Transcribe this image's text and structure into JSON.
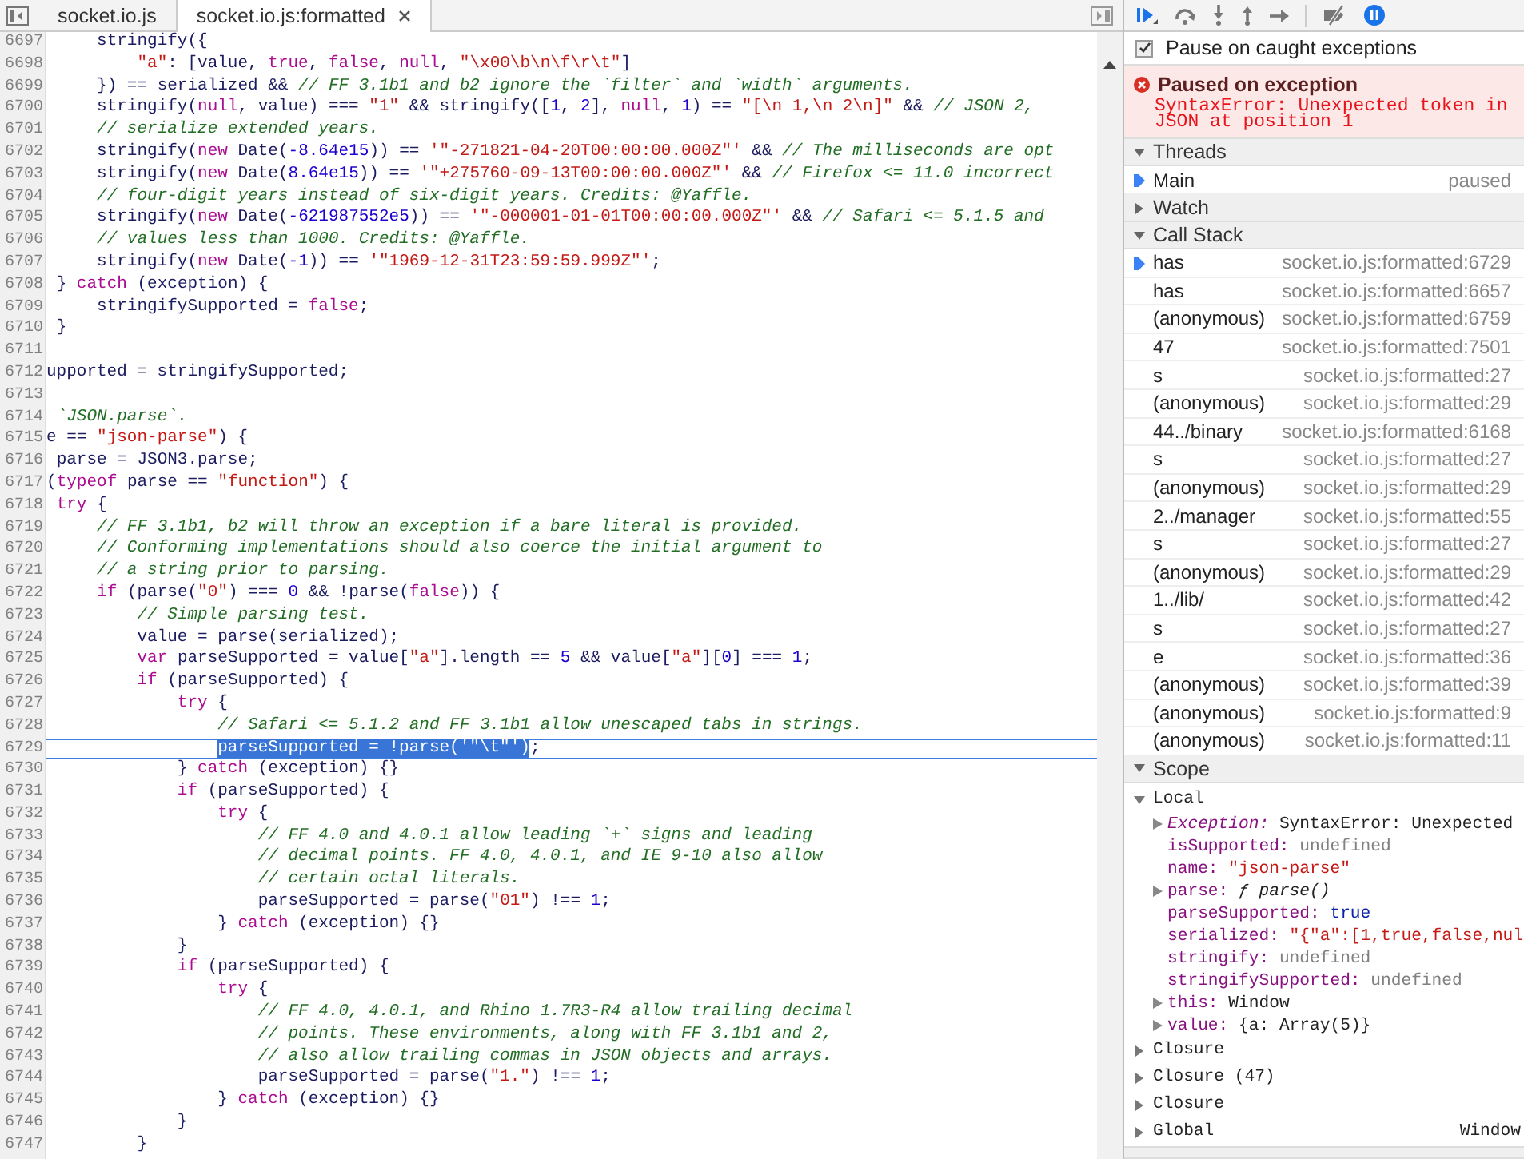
{
  "editor": {
    "tabs": [
      {
        "label": "socket.io.js",
        "selected": false,
        "closable": false
      },
      {
        "label": "socket.io.js:formatted",
        "selected": true,
        "closable": true
      }
    ],
    "lines": [
      {
        "number": "6697",
        "current": false,
        "tokens": [
          {
            "kind": "p",
            "text": "     stringify({"
          }
        ]
      },
      {
        "number": "6698",
        "current": false,
        "tokens": [
          {
            "kind": "str",
            "text": "         \"a\""
          },
          {
            "kind": "p",
            "text": ": [value, "
          },
          {
            "kind": "kw",
            "text": "true"
          },
          {
            "kind": "p",
            "text": ", "
          },
          {
            "kind": "kw",
            "text": "false"
          },
          {
            "kind": "p",
            "text": ", "
          },
          {
            "kind": "kw",
            "text": "null"
          },
          {
            "kind": "p",
            "text": ", "
          },
          {
            "kind": "str",
            "text": "\"\\x00\\b\\n\\f\\r\\t\""
          },
          {
            "kind": "p",
            "text": "]"
          }
        ]
      },
      {
        "number": "6699",
        "current": false,
        "tokens": [
          {
            "kind": "p",
            "text": "     }) == serialized && "
          },
          {
            "kind": "cm",
            "text": "// FF 3.1b1 and b2 ignore the `filter` and `width` arguments."
          }
        ]
      },
      {
        "number": "6700",
        "current": false,
        "tokens": [
          {
            "kind": "p",
            "text": "     stringify("
          },
          {
            "kind": "kw",
            "text": "null"
          },
          {
            "kind": "p",
            "text": ", value) === "
          },
          {
            "kind": "str",
            "text": "\"1\""
          },
          {
            "kind": "p",
            "text": " && stringify(["
          },
          {
            "kind": "num",
            "text": "1"
          },
          {
            "kind": "p",
            "text": ", "
          },
          {
            "kind": "num",
            "text": "2"
          },
          {
            "kind": "p",
            "text": "], "
          },
          {
            "kind": "kw",
            "text": "null"
          },
          {
            "kind": "p",
            "text": ", "
          },
          {
            "kind": "num",
            "text": "1"
          },
          {
            "kind": "p",
            "text": ") == "
          },
          {
            "kind": "str",
            "text": "\"[\\n 1,\\n 2\\n]\""
          },
          {
            "kind": "p",
            "text": " && "
          },
          {
            "kind": "cm",
            "text": "// JSON 2,"
          }
        ]
      },
      {
        "number": "6701",
        "current": false,
        "tokens": [
          {
            "kind": "cm",
            "text": "     // serialize extended years."
          }
        ]
      },
      {
        "number": "6702",
        "current": false,
        "tokens": [
          {
            "kind": "p",
            "text": "     stringify("
          },
          {
            "kind": "kw",
            "text": "new"
          },
          {
            "kind": "p",
            "text": " Date("
          },
          {
            "kind": "num",
            "text": "-8.64e15"
          },
          {
            "kind": "p",
            "text": ")) == "
          },
          {
            "kind": "str",
            "text": "'\"-271821-04-20T00:00:00.000Z\"'"
          },
          {
            "kind": "p",
            "text": " && "
          },
          {
            "kind": "cm",
            "text": "// The milliseconds are opt"
          }
        ]
      },
      {
        "number": "6703",
        "current": false,
        "tokens": [
          {
            "kind": "p",
            "text": "     stringify("
          },
          {
            "kind": "kw",
            "text": "new"
          },
          {
            "kind": "p",
            "text": " Date("
          },
          {
            "kind": "num",
            "text": "8.64e15"
          },
          {
            "kind": "p",
            "text": ")) == "
          },
          {
            "kind": "str",
            "text": "'\"+275760-09-13T00:00:00.000Z\"'"
          },
          {
            "kind": "p",
            "text": " && "
          },
          {
            "kind": "cm",
            "text": "// Firefox <= 11.0 incorrect"
          }
        ]
      },
      {
        "number": "6704",
        "current": false,
        "tokens": [
          {
            "kind": "cm",
            "text": "     // four-digit years instead of six-digit years. Credits: @Yaffle."
          }
        ]
      },
      {
        "number": "6705",
        "current": false,
        "tokens": [
          {
            "kind": "p",
            "text": "     stringify("
          },
          {
            "kind": "kw",
            "text": "new"
          },
          {
            "kind": "p",
            "text": " Date("
          },
          {
            "kind": "num",
            "text": "-621987552e5"
          },
          {
            "kind": "p",
            "text": ")) == "
          },
          {
            "kind": "str",
            "text": "'\"-000001-01-01T00:00:00.000Z\"'"
          },
          {
            "kind": "p",
            "text": " && "
          },
          {
            "kind": "cm",
            "text": "// Safari <= 5.1.5 and"
          }
        ]
      },
      {
        "number": "6706",
        "current": false,
        "tokens": [
          {
            "kind": "cm",
            "text": "     // values less than 1000. Credits: @Yaffle."
          }
        ]
      },
      {
        "number": "6707",
        "current": false,
        "tokens": [
          {
            "kind": "p",
            "text": "     stringify("
          },
          {
            "kind": "kw",
            "text": "new"
          },
          {
            "kind": "p",
            "text": " Date("
          },
          {
            "kind": "num",
            "text": "-1"
          },
          {
            "kind": "p",
            "text": ")) == "
          },
          {
            "kind": "str",
            "text": "'\"1969-12-31T23:59:59.999Z\"'"
          },
          {
            "kind": "p",
            "text": ";"
          }
        ]
      },
      {
        "number": "6708",
        "current": false,
        "tokens": [
          {
            "kind": "p",
            "text": " } "
          },
          {
            "kind": "kw",
            "text": "catch"
          },
          {
            "kind": "p",
            "text": " (exception) {"
          }
        ]
      },
      {
        "number": "6709",
        "current": false,
        "tokens": [
          {
            "kind": "p",
            "text": "     stringifySupported = "
          },
          {
            "kind": "kw",
            "text": "false"
          },
          {
            "kind": "p",
            "text": ";"
          }
        ]
      },
      {
        "number": "6710",
        "current": false,
        "tokens": [
          {
            "kind": "p",
            "text": " }"
          }
        ]
      },
      {
        "number": "6711",
        "current": false
      },
      {
        "number": "6712",
        "current": false,
        "tokens": [
          {
            "kind": "p",
            "text": "upported = stringifySupported;"
          }
        ]
      },
      {
        "number": "6713",
        "current": false
      },
      {
        "number": "6714",
        "current": false,
        "tokens": [
          {
            "kind": "cm",
            "text": " `JSON.parse`."
          }
        ]
      },
      {
        "number": "6715",
        "current": false,
        "tokens": [
          {
            "kind": "p",
            "text": "e == "
          },
          {
            "kind": "str",
            "text": "\"json-parse\""
          },
          {
            "kind": "p",
            "text": ") {"
          }
        ]
      },
      {
        "number": "6716",
        "current": false,
        "tokens": [
          {
            "kind": "p",
            "text": " parse = JSON3.parse;"
          }
        ]
      },
      {
        "number": "6717",
        "current": false,
        "tokens": [
          {
            "kind": "p",
            "text": "("
          },
          {
            "kind": "kw",
            "text": "typeof"
          },
          {
            "kind": "p",
            "text": " parse == "
          },
          {
            "kind": "str",
            "text": "\"function\""
          },
          {
            "kind": "p",
            "text": ") {"
          }
        ]
      },
      {
        "number": "6718",
        "current": false,
        "tokens": [
          {
            "kind": "kw",
            "text": " try"
          },
          {
            "kind": "p",
            "text": " {"
          }
        ]
      },
      {
        "number": "6719",
        "current": false,
        "tokens": [
          {
            "kind": "cm",
            "text": "     // FF 3.1b1, b2 will throw an exception if a bare literal is provided."
          }
        ]
      },
      {
        "number": "6720",
        "current": false,
        "tokens": [
          {
            "kind": "cm",
            "text": "     // Conforming implementations should also coerce the initial argument to"
          }
        ]
      },
      {
        "number": "6721",
        "current": false,
        "tokens": [
          {
            "kind": "cm",
            "text": "     // a string prior to parsing."
          }
        ]
      },
      {
        "number": "6722",
        "current": false,
        "tokens": [
          {
            "kind": "kw",
            "text": "     if"
          },
          {
            "kind": "p",
            "text": " (parse("
          },
          {
            "kind": "str",
            "text": "\"0\""
          },
          {
            "kind": "p",
            "text": ") === "
          },
          {
            "kind": "num",
            "text": "0"
          },
          {
            "kind": "p",
            "text": " && !parse("
          },
          {
            "kind": "kw",
            "text": "false"
          },
          {
            "kind": "p",
            "text": ")) {"
          }
        ]
      },
      {
        "number": "6723",
        "current": false,
        "tokens": [
          {
            "kind": "cm",
            "text": "         // Simple parsing test."
          }
        ]
      },
      {
        "number": "6724",
        "current": false,
        "tokens": [
          {
            "kind": "p",
            "text": "         value = parse(serialized);"
          }
        ]
      },
      {
        "number": "6725",
        "current": false,
        "tokens": [
          {
            "kind": "kw",
            "text": "         var"
          },
          {
            "kind": "p",
            "text": " parseSupported = value["
          },
          {
            "kind": "str",
            "text": "\"a\""
          },
          {
            "kind": "p",
            "text": "].length == "
          },
          {
            "kind": "num",
            "text": "5"
          },
          {
            "kind": "p",
            "text": " && value["
          },
          {
            "kind": "str",
            "text": "\"a\""
          },
          {
            "kind": "p",
            "text": "]["
          },
          {
            "kind": "num",
            "text": "0"
          },
          {
            "kind": "p",
            "text": "] === "
          },
          {
            "kind": "num",
            "text": "1"
          },
          {
            "kind": "p",
            "text": ";"
          }
        ]
      },
      {
        "number": "6726",
        "current": false,
        "tokens": [
          {
            "kind": "kw",
            "text": "         if"
          },
          {
            "kind": "p",
            "text": " (parseSupported) {"
          }
        ]
      },
      {
        "number": "6727",
        "current": false,
        "tokens": [
          {
            "kind": "kw",
            "text": "             try"
          },
          {
            "kind": "p",
            "text": " {"
          }
        ]
      },
      {
        "number": "6728",
        "current": false,
        "tokens": [
          {
            "kind": "cm",
            "text": "                 // Safari <= 5.1.2 and FF 3.1b1 allow unescaped tabs in strings."
          }
        ]
      },
      {
        "number": "6729",
        "current": true,
        "tokens": [
          {
            "kind": "sel",
            "text": "                 parseSupported = !parse('\"\\t\"')"
          },
          {
            "kind": "p",
            "text": ";"
          }
        ]
      },
      {
        "number": "6730",
        "current": false,
        "tokens": [
          {
            "kind": "p",
            "text": "             } "
          },
          {
            "kind": "kw",
            "text": "catch"
          },
          {
            "kind": "p",
            "text": " (exception) {}"
          }
        ]
      },
      {
        "number": "6731",
        "current": false,
        "tokens": [
          {
            "kind": "kw",
            "text": "             if"
          },
          {
            "kind": "p",
            "text": " (parseSupported) {"
          }
        ]
      },
      {
        "number": "6732",
        "current": false,
        "tokens": [
          {
            "kind": "kw",
            "text": "                 try"
          },
          {
            "kind": "p",
            "text": " {"
          }
        ]
      },
      {
        "number": "6733",
        "current": false,
        "tokens": [
          {
            "kind": "cm",
            "text": "                     // FF 4.0 and 4.0.1 allow leading `+` signs and leading"
          }
        ]
      },
      {
        "number": "6734",
        "current": false,
        "tokens": [
          {
            "kind": "cm",
            "text": "                     // decimal points. FF 4.0, 4.0.1, and IE 9-10 also allow"
          }
        ]
      },
      {
        "number": "6735",
        "current": false,
        "tokens": [
          {
            "kind": "cm",
            "text": "                     // certain octal literals."
          }
        ]
      },
      {
        "number": "6736",
        "current": false,
        "tokens": [
          {
            "kind": "p",
            "text": "                     parseSupported = parse("
          },
          {
            "kind": "str",
            "text": "\"01\""
          },
          {
            "kind": "p",
            "text": ") !== "
          },
          {
            "kind": "num",
            "text": "1"
          },
          {
            "kind": "p",
            "text": ";"
          }
        ]
      },
      {
        "number": "6737",
        "current": false,
        "tokens": [
          {
            "kind": "p",
            "text": "                 } "
          },
          {
            "kind": "kw",
            "text": "catch"
          },
          {
            "kind": "p",
            "text": " (exception) {}"
          }
        ]
      },
      {
        "number": "6738",
        "current": false,
        "tokens": [
          {
            "kind": "p",
            "text": "             }"
          }
        ]
      },
      {
        "number": "6739",
        "current": false,
        "tokens": [
          {
            "kind": "kw",
            "text": "             if"
          },
          {
            "kind": "p",
            "text": " (parseSupported) {"
          }
        ]
      },
      {
        "number": "6740",
        "current": false,
        "tokens": [
          {
            "kind": "kw",
            "text": "                 try"
          },
          {
            "kind": "p",
            "text": " {"
          }
        ]
      },
      {
        "number": "6741",
        "current": false,
        "tokens": [
          {
            "kind": "cm",
            "text": "                     // FF 4.0, 4.0.1, and Rhino 1.7R3-R4 allow trailing decimal"
          }
        ]
      },
      {
        "number": "6742",
        "current": false,
        "tokens": [
          {
            "kind": "cm",
            "text": "                     // points. These environments, along with FF 3.1b1 and 2,"
          }
        ]
      },
      {
        "number": "6743",
        "current": false,
        "tokens": [
          {
            "kind": "cm",
            "text": "                     // also allow trailing commas in JSON objects and arrays."
          }
        ]
      },
      {
        "number": "6744",
        "current": false,
        "tokens": [
          {
            "kind": "p",
            "text": "                     parseSupported = parse("
          },
          {
            "kind": "str",
            "text": "\"1.\""
          },
          {
            "kind": "p",
            "text": ") !== "
          },
          {
            "kind": "num",
            "text": "1"
          },
          {
            "kind": "p",
            "text": ";"
          }
        ]
      },
      {
        "number": "6745",
        "current": false,
        "tokens": [
          {
            "kind": "p",
            "text": "                 } "
          },
          {
            "kind": "kw",
            "text": "catch"
          },
          {
            "kind": "p",
            "text": " (exception) {}"
          }
        ]
      },
      {
        "number": "6746",
        "current": false,
        "tokens": [
          {
            "kind": "p",
            "text": "             }"
          }
        ]
      },
      {
        "number": "6747",
        "current": false,
        "tokens": [
          {
            "kind": "p",
            "text": "         }"
          }
        ]
      }
    ]
  },
  "debugger": {
    "pause_on_exceptions_active": true,
    "pause_on_caught": {
      "label": "Pause on caught exceptions",
      "checked": true
    },
    "exception": {
      "title": "Paused on exception",
      "message": "SyntaxError: Unexpected token in JSON at position 1"
    },
    "threads": {
      "title": "Threads",
      "expanded": true,
      "items": [
        {
          "name": "Main",
          "status": "paused",
          "selected": true
        }
      ]
    },
    "watch": {
      "title": "Watch",
      "expanded": false
    },
    "call_stack": {
      "title": "Call Stack",
      "expanded": true,
      "frames": [
        {
          "function": "has",
          "location": "socket.io.js:formatted:6729",
          "selected": true
        },
        {
          "function": "has",
          "location": "socket.io.js:formatted:6657",
          "selected": false
        },
        {
          "function": "(anonymous)",
          "location": "socket.io.js:formatted:6759",
          "selected": false
        },
        {
          "function": "47",
          "location": "socket.io.js:formatted:7501",
          "selected": false
        },
        {
          "function": "s",
          "location": "socket.io.js:formatted:27",
          "selected": false
        },
        {
          "function": "(anonymous)",
          "location": "socket.io.js:formatted:29",
          "selected": false
        },
        {
          "function": "44../binary",
          "location": "socket.io.js:formatted:6168",
          "selected": false
        },
        {
          "function": "s",
          "location": "socket.io.js:formatted:27",
          "selected": false
        },
        {
          "function": "(anonymous)",
          "location": "socket.io.js:formatted:29",
          "selected": false
        },
        {
          "function": "2../manager",
          "location": "socket.io.js:formatted:55",
          "selected": false
        },
        {
          "function": "s",
          "location": "socket.io.js:formatted:27",
          "selected": false
        },
        {
          "function": "(anonymous)",
          "location": "socket.io.js:formatted:29",
          "selected": false
        },
        {
          "function": "1../lib/",
          "location": "socket.io.js:formatted:42",
          "selected": false
        },
        {
          "function": "s",
          "location": "socket.io.js:formatted:27",
          "selected": false
        },
        {
          "function": "e",
          "location": "socket.io.js:formatted:36",
          "selected": false
        },
        {
          "function": "(anonymous)",
          "location": "socket.io.js:formatted:39",
          "selected": false
        },
        {
          "function": "(anonymous)",
          "location": "socket.io.js:formatted:9",
          "selected": false
        },
        {
          "function": "(anonymous)",
          "location": "socket.io.js:formatted:11",
          "selected": false
        }
      ]
    },
    "scope": {
      "title": "Scope",
      "expanded": true,
      "scopes": [
        {
          "name": "Local",
          "expanded": true,
          "variables": [
            {
              "kind": "exception",
              "name": "Exception:",
              "value": "SyntaxError: Unexpected",
              "expandable": true
            },
            {
              "kind": "undefined",
              "name": "isSupported:",
              "value": "undefined",
              "expandable": false
            },
            {
              "kind": "string",
              "name": "name:",
              "value": "\"json-parse\"",
              "expandable": false
            },
            {
              "kind": "function",
              "name": "parse:",
              "value": "ƒ parse()",
              "expandable": true
            },
            {
              "kind": "boolean",
              "name": "parseSupported:",
              "value": "true",
              "expandable": false
            },
            {
              "kind": "string",
              "name": "serialized:",
              "value": "\"{\"a\":[1,true,false,nul",
              "expandable": false
            },
            {
              "kind": "undefined",
              "name": "stringify:",
              "value": "undefined",
              "expandable": false
            },
            {
              "kind": "undefined",
              "name": "stringifySupported:",
              "value": "undefined",
              "expandable": false
            },
            {
              "kind": "object",
              "name": "this:",
              "value": "Window",
              "expandable": true
            },
            {
              "kind": "object",
              "name": "value:",
              "value": "{a: Array(5)}",
              "expandable": true
            }
          ]
        },
        {
          "name": "Closure",
          "expanded": false
        },
        {
          "name": "Closure (47)",
          "expanded": false
        },
        {
          "name": "Closure",
          "expanded": false
        },
        {
          "name": "Global",
          "value": "Window",
          "expanded": false
        }
      ]
    }
  }
}
